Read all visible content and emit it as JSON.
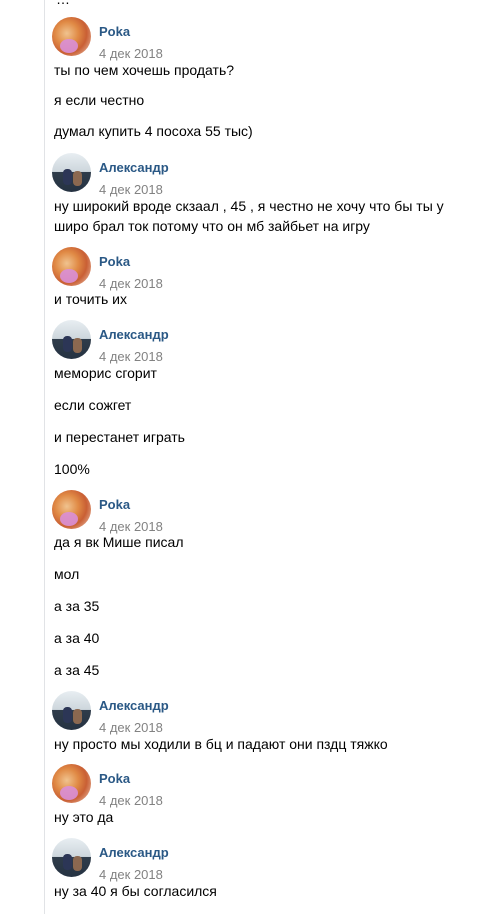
{
  "top_fragment": "…",
  "messages": [
    {
      "author": "Poka",
      "date": "4 дек 2018",
      "lines": [
        "ты по чем хочешь продать?",
        "я если честно",
        "думал купить 4 посоха 55 тыс)"
      ]
    },
    {
      "author": "Александр",
      "date": "4 дек 2018",
      "lines": [
        "ну широкий вроде скзаал , 45 , я честно не хочу что бы ты у",
        "широ брал ток потому что он мб зайбьет на игру"
      ]
    },
    {
      "author": "Poka",
      "date": "4 дек 2018",
      "lines": [
        "и точить их"
      ]
    },
    {
      "author": "Александр",
      "date": "4 дек 2018",
      "lines": [
        "меморис сгорит",
        "если сожгет",
        "и перестанет играть",
        "100%"
      ]
    },
    {
      "author": "Poka",
      "date": "4 дек 2018",
      "lines": [
        "да я вк Мише писал",
        "мол",
        "а за 35",
        "а за 40",
        "а за 45"
      ]
    },
    {
      "author": "Александр",
      "date": "4 дек 2018",
      "lines": [
        "ну просто мы ходили в бц и падают они пздц тяжко"
      ]
    },
    {
      "author": "Poka",
      "date": "4 дек 2018",
      "lines": [
        "ну это да"
      ]
    },
    {
      "author": "Александр",
      "date": "4 дек 2018",
      "lines": [
        "ну за 40 я бы согласился"
      ]
    }
  ]
}
